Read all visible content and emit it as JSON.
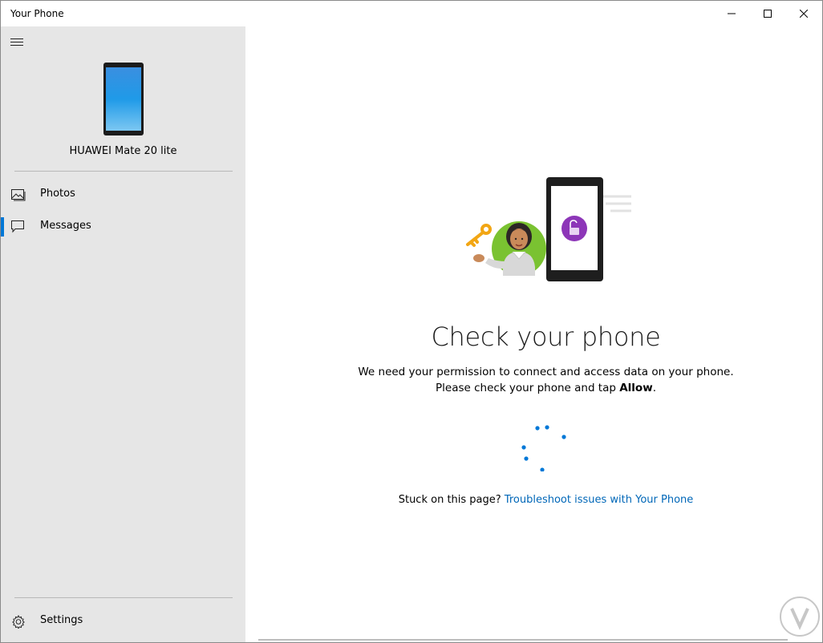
{
  "window": {
    "title": "Your Phone",
    "controls": [
      "minimize-icon",
      "maximize-icon",
      "close-icon"
    ]
  },
  "sidebar": {
    "menu_icon": "hamburger-icon",
    "device_name": "HUAWEI Mate 20 lite",
    "items": [
      {
        "label": "Photos",
        "icon": "photos-icon",
        "active": false
      },
      {
        "label": "Messages",
        "icon": "messages-icon",
        "active": true
      }
    ],
    "settings_label": "Settings",
    "settings_icon": "gear-icon"
  },
  "main": {
    "heading": "Check your phone",
    "line1": "We need your permission to connect and access data on your phone.",
    "line2_prefix": "Please check your phone and tap ",
    "line2_bold": "Allow",
    "line2_suffix": ".",
    "stuck_text": "Stuck on this page? ",
    "troubleshoot_link": "Troubleshoot issues with Your Phone"
  },
  "colors": {
    "accent": "#0078d7",
    "link": "#0067b8",
    "sidebar_bg": "#e6e6e6"
  }
}
